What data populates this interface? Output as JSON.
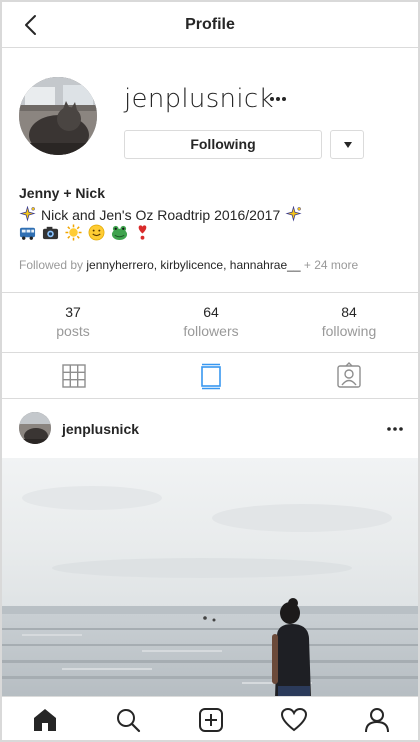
{
  "header": {
    "title": "Profile",
    "back_icon": "back-chevron-icon"
  },
  "profile": {
    "username": "jenplusnick",
    "following_label": "Following",
    "display_name": "Jenny + Nick",
    "bio_line": "Nick and Jen's Oz Roadtrip 2016/2017",
    "bio_emojis": [
      "sparkles-icon",
      "bus-icon",
      "camera-icon",
      "sun-icon",
      "smiley-icon",
      "frog-icon",
      "heart-exclamation-icon"
    ],
    "followed_by_prefix": "Followed by",
    "followed_by_names": "jennyherrero, kirbylicence, hannahrae__",
    "followed_by_more": "+ 24 more"
  },
  "stats": [
    {
      "value": "37",
      "label": "posts"
    },
    {
      "value": "64",
      "label": "followers"
    },
    {
      "value": "84",
      "label": "following"
    }
  ],
  "view_tabs": {
    "active": "feed",
    "items": [
      "grid-icon",
      "feed-icon",
      "tagged-icon"
    ]
  },
  "post": {
    "username": "jenplusnick"
  },
  "bottom_nav": [
    "home-icon",
    "search-icon",
    "new-post-icon",
    "activity-heart-icon",
    "profile-icon"
  ],
  "colors": {
    "accent": "#3897f0",
    "text": "#262626",
    "muted": "#999999",
    "border": "#dbdbdb"
  }
}
